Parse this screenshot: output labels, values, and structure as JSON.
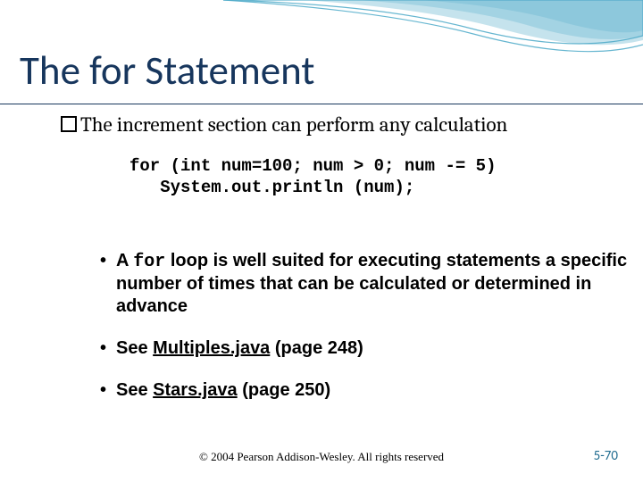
{
  "title": "The for Statement",
  "intro": "The increment section can perform any calculation",
  "code": {
    "line1": "for (int num=100; num > 0; num -= 5)",
    "line2": "   System.out.println (num);"
  },
  "bullets": {
    "b1_pre": "A ",
    "b1_code": "for",
    "b1_post": " loop is well suited for executing statements a specific number of times that can be calculated or determined in advance",
    "b2_pre": "See ",
    "b2_link": "Multiples.java",
    "b2_post": " (page 248)",
    "b3_pre": "See ",
    "b3_link": "Stars.java",
    "b3_post": " (page 250)"
  },
  "footer": {
    "copyright": "© 2004 Pearson Addison-Wesley. All rights reserved",
    "page": "5-70"
  }
}
